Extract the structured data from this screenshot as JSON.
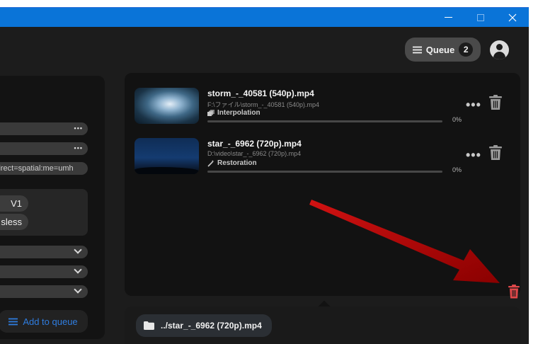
{
  "titlebar": {
    "icons": [
      "minimize-icon",
      "maximize-icon",
      "close-icon"
    ]
  },
  "header": {
    "queue_label": "Queue",
    "queue_count": "2"
  },
  "sidebar": {
    "args_text": "lirect=spatial:me=umh",
    "chip_1": "V1",
    "chip_2": "sless",
    "add_to_queue_label": "Add to queue"
  },
  "queue": {
    "items": [
      {
        "title": "storm_-_40581 (540p).mp4",
        "path": "F:\\ファイル\\storm_-_40581 (540p).mp4",
        "task": "Interpolation",
        "task_icon": "interpolation-icon",
        "progress_pct": 0,
        "progress_label": "0%"
      },
      {
        "title": "star_-_6962 (720p).mp4",
        "path": "D:\\video\\star_-_6962 (720p).mp4",
        "task": "Restoration",
        "task_icon": "magic-wand-icon",
        "progress_pct": 0,
        "progress_label": "0%"
      }
    ]
  },
  "output": {
    "file_label": "../star_-_6962 (720p).mp4"
  },
  "colors": {
    "titlebar": "#0a74d8",
    "accent": "#2f7de0",
    "danger": "#e0484a",
    "annotation_arrow": "#b30000"
  }
}
